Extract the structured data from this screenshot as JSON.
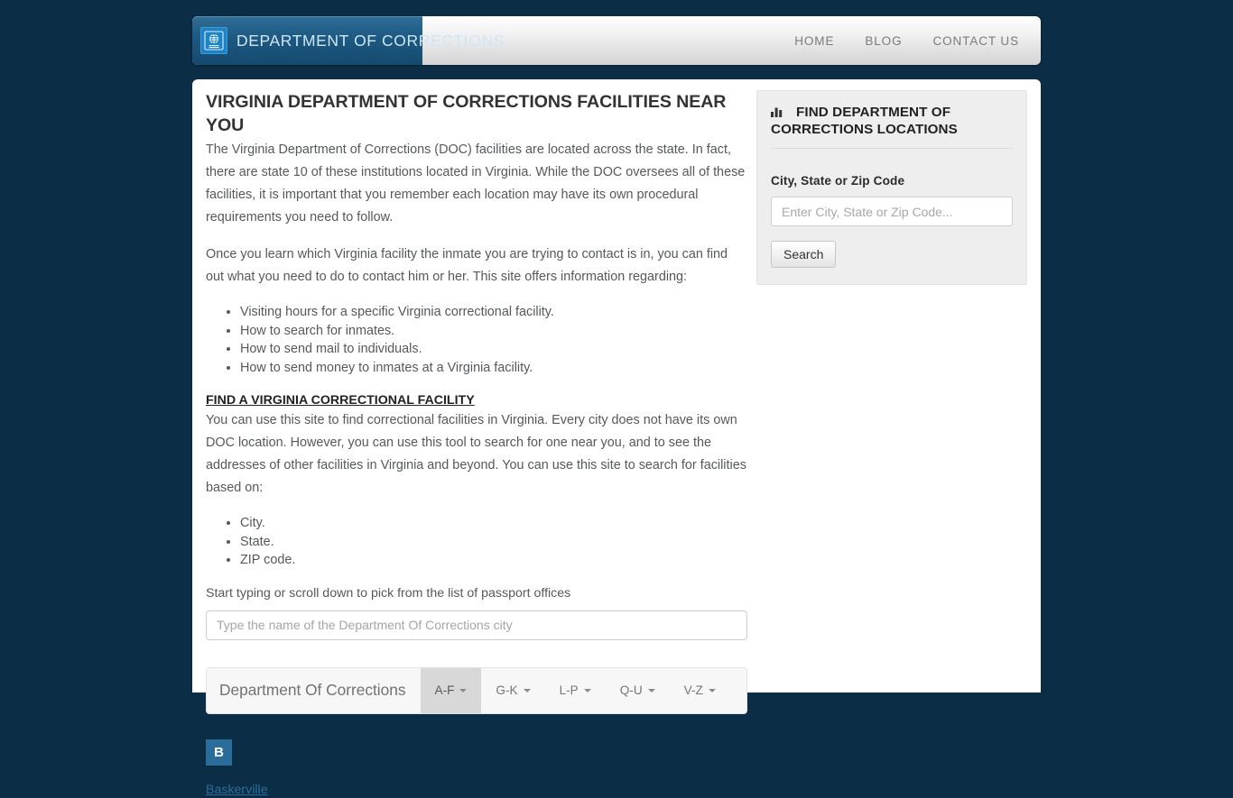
{
  "header": {
    "brand_name": "DEPARTMENT OF CORRECTIONS",
    "logo_icon": "globe-passport-icon",
    "nav": [
      {
        "label": "HOME"
      },
      {
        "label": "BLOG"
      },
      {
        "label": "CONTACT US"
      }
    ]
  },
  "main": {
    "title": "VIRGINIA DEPARTMENT OF CORRECTIONS FACILITIES NEAR YOU",
    "intro_paragraph": "The Virginia Department of Corrections (DOC) facilities are located across the state. In fact, there are state 10 of these institutions located in Virginia. While the DOC oversees all of these facilities, it is important that you remember each location may have its own procedural requirements you need to follow.",
    "second_paragraph": "Once you learn which Virginia facility the inmate you are trying to contact is in, you can find out what you need to do to contact him or her. This site offers information regarding:",
    "info_list": [
      "Visiting hours for a specific Virginia correctional facility.",
      "How to search for inmates.",
      "How to send mail to individuals.",
      "How to send money to inmates at a Virginia facility."
    ],
    "find_heading": "FIND A VIRGINIA CORRECTIONAL FACILITY",
    "find_paragraph": "You can use this site to find correctional facilities in Virginia. Every city does not have its own DOC location. However, you can use this tool to search for one near you, and to see the addresses of other facilities in Virginia and beyond. You can use this site to search for facilities based on:",
    "search_basis_list": [
      "City.",
      "State.",
      "ZIP code."
    ],
    "typeahead_hint": "Start typing or scroll down to pick from the list of passport offices",
    "typeahead_placeholder": "Type the name of the Department Of Corrections city",
    "typeahead_value": ""
  },
  "tabs": {
    "brand_label": "Department Of Corrections",
    "items": [
      {
        "label": "A-F",
        "active": true
      },
      {
        "label": "G-K",
        "active": false
      },
      {
        "label": "L-P",
        "active": false
      },
      {
        "label": "Q-U",
        "active": false
      },
      {
        "label": "V-Z",
        "active": false
      }
    ]
  },
  "letter_groups": [
    {
      "letter": "B",
      "cities": [
        {
          "name": "Baskerville"
        }
      ]
    }
  ],
  "sidebar": {
    "widget_icon": "bar-chart-icon",
    "widget_title": "FIND DEPARTMENT OF CORRECTIONS LOCATIONS",
    "field_label": "City, State or Zip Code",
    "input_placeholder": "Enter City, State or Zip Code...",
    "input_value": "",
    "search_button_label": "Search"
  },
  "colors": {
    "page_background": "#0b2d45",
    "brand_blue": "#1d5982",
    "logo_blue": "#1c84c6",
    "link_blue": "#2b6d9a",
    "badge_blue": "#2b6d9a",
    "widget_background": "#eeeeee",
    "tab_active_background": "#d8d8d8",
    "body_text": "#55595c"
  }
}
